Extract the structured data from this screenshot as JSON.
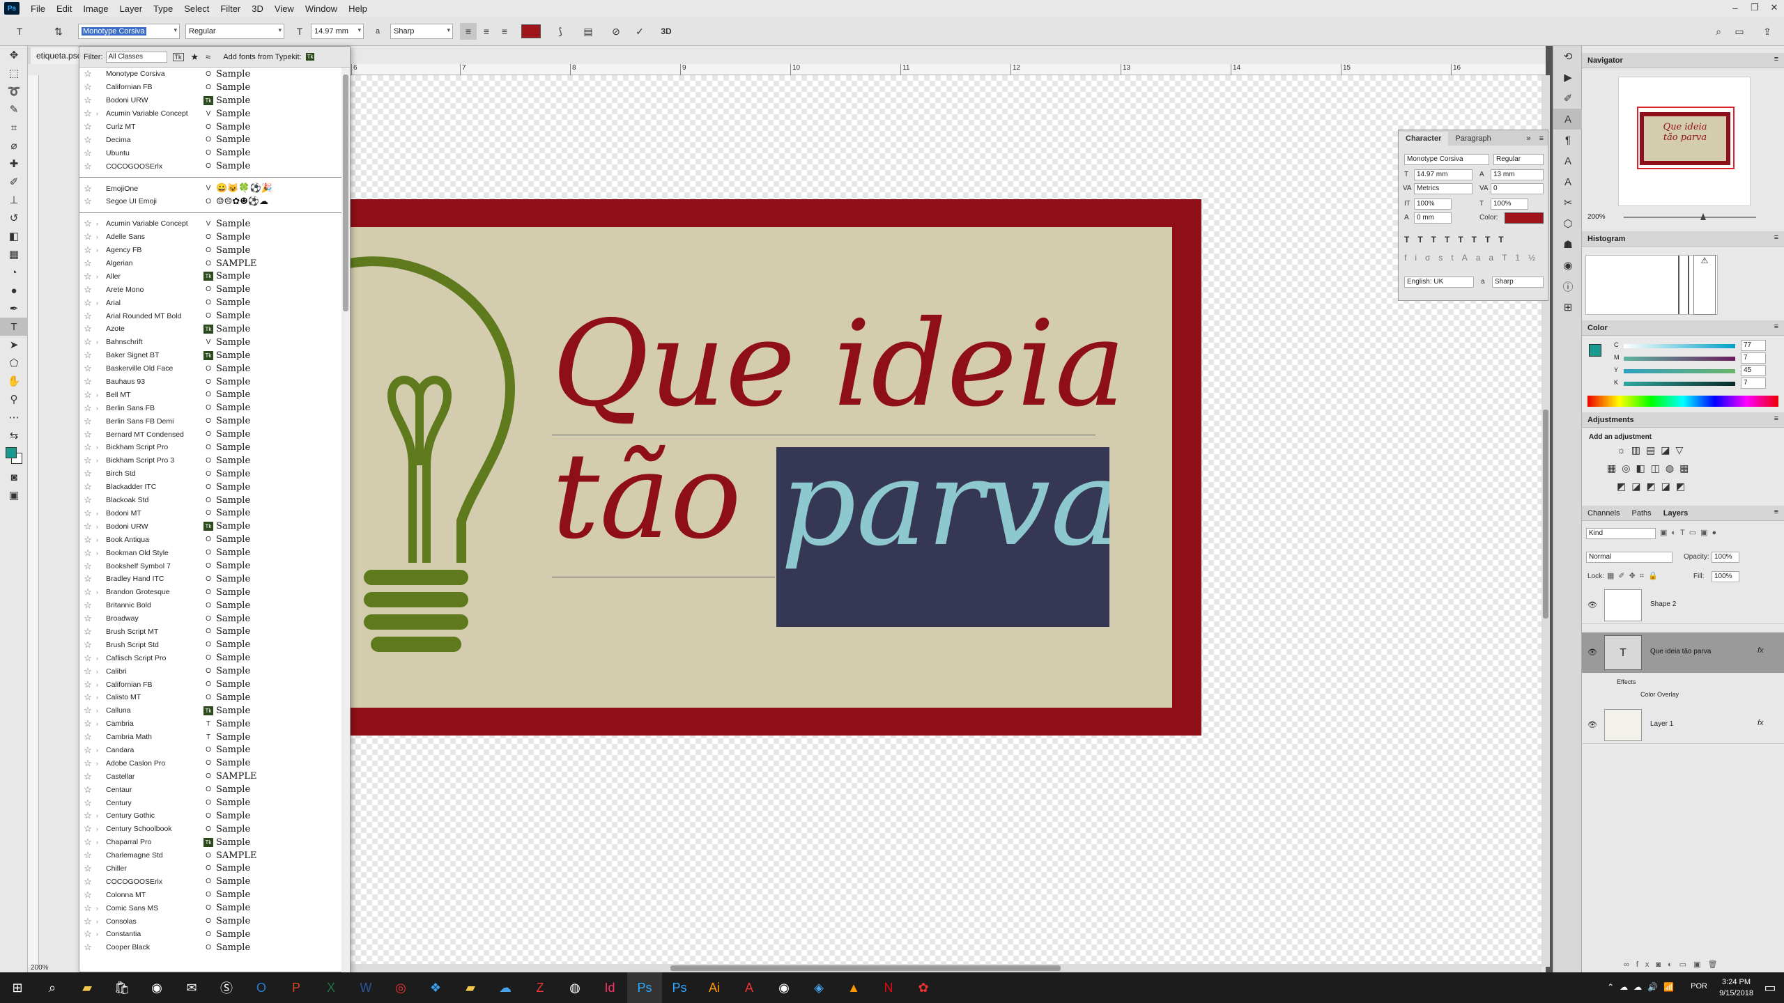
{
  "menubar": {
    "app_logo": "Ps",
    "items": [
      "File",
      "Edit",
      "Image",
      "Layer",
      "Type",
      "Select",
      "Filter",
      "3D",
      "View",
      "Window",
      "Help"
    ]
  },
  "options": {
    "font_family": "Monotype Corsiva",
    "font_style": "Regular",
    "font_size": "14.97 mm",
    "aa_label": "a",
    "aa_value": "Sharp",
    "color": "#a0141c",
    "warp_label": "3D"
  },
  "document": {
    "tab_name": "etiqueta.psd",
    "zoom": "200%",
    "ruler_ticks": [
      "6",
      "7",
      "8",
      "9",
      "10",
      "11",
      "12",
      "13",
      "14",
      "15",
      "16"
    ],
    "artwork": {
      "line1": "Que ideia",
      "line2_a": "tão",
      "line2_b": "parva",
      "border_color": "#8e0f18",
      "bg_color": "#d3ccae",
      "text_color": "#8e0f18",
      "highlight_bg": "#353754",
      "highlight_text": "#8ec8cf",
      "bulb_color": "#5e7a1d"
    }
  },
  "font_menu": {
    "filter_label": "Filter:",
    "filter_value": "All Classes",
    "typekit_label": "Add fonts from Typekit:",
    "recent": [
      {
        "name": "Monotype Corsiva",
        "type": "O",
        "sample": "Sample"
      },
      {
        "name": "Californian FB",
        "type": "O",
        "sample": "Sample"
      },
      {
        "name": "Bodoni URW",
        "type": "Tk",
        "sample": "Sample"
      },
      {
        "name": "Acumin Variable Concept",
        "type": "V",
        "sample": "Sample",
        "arrow": true
      },
      {
        "name": "Curlz MT",
        "type": "O",
        "sample": "Sample"
      },
      {
        "name": "Decima",
        "type": "O",
        "sample": "Sample"
      },
      {
        "name": "Ubuntu",
        "type": "O",
        "sample": "Sample"
      },
      {
        "name": "COCOGOOSErlx",
        "type": "O",
        "sample": "Sample"
      }
    ],
    "emoji": [
      {
        "name": "EmojiOne",
        "type": "V",
        "sample": "😀😺🍀⚽🎉"
      },
      {
        "name": "Segoe UI Emoji",
        "type": "O",
        "sample": "☺☹✿☻⚽☁"
      }
    ],
    "all": [
      {
        "name": "Acumin Variable Concept",
        "type": "V",
        "sample": "Sample",
        "arrow": true
      },
      {
        "name": "Adelle Sans",
        "type": "O",
        "sample": "Sample",
        "arrow": true
      },
      {
        "name": "Agency FB",
        "type": "O",
        "sample": "Sample",
        "arrow": true
      },
      {
        "name": "Algerian",
        "type": "O",
        "sample": "SAMPLE"
      },
      {
        "name": "Aller",
        "type": "Tk",
        "sample": "Sample",
        "arrow": true
      },
      {
        "name": "Arete Mono",
        "type": "O",
        "sample": "Sample"
      },
      {
        "name": "Arial",
        "type": "O",
        "sample": "Sample",
        "arrow": true
      },
      {
        "name": "Arial Rounded MT Bold",
        "type": "O",
        "sample": "Sample"
      },
      {
        "name": "Azote",
        "type": "Tk",
        "sample": "Sample"
      },
      {
        "name": "Bahnschrift",
        "type": "V",
        "sample": "Sample",
        "arrow": true
      },
      {
        "name": "Baker Signet BT",
        "type": "Tk",
        "sample": "Sample"
      },
      {
        "name": "Baskerville Old Face",
        "type": "O",
        "sample": "Sample"
      },
      {
        "name": "Bauhaus 93",
        "type": "O",
        "sample": "Sample"
      },
      {
        "name": "Bell MT",
        "type": "O",
        "sample": "Sample",
        "arrow": true
      },
      {
        "name": "Berlin Sans FB",
        "type": "O",
        "sample": "Sample",
        "arrow": true
      },
      {
        "name": "Berlin Sans FB Demi",
        "type": "O",
        "sample": "Sample"
      },
      {
        "name": "Bernard MT Condensed",
        "type": "O",
        "sample": "Sample"
      },
      {
        "name": "Bickham Script Pro",
        "type": "O",
        "sample": "Sample",
        "arrow": true
      },
      {
        "name": "Bickham Script Pro 3",
        "type": "O",
        "sample": "Sample",
        "arrow": true
      },
      {
        "name": "Birch Std",
        "type": "O",
        "sample": "Sample"
      },
      {
        "name": "Blackadder ITC",
        "type": "O",
        "sample": "Sample"
      },
      {
        "name": "Blackoak Std",
        "type": "O",
        "sample": "Sample"
      },
      {
        "name": "Bodoni MT",
        "type": "O",
        "sample": "Sample",
        "arrow": true
      },
      {
        "name": "Bodoni URW",
        "type": "Tk",
        "sample": "Sample",
        "arrow": true
      },
      {
        "name": "Book Antiqua",
        "type": "O",
        "sample": "Sample",
        "arrow": true
      },
      {
        "name": "Bookman Old Style",
        "type": "O",
        "sample": "Sample",
        "arrow": true
      },
      {
        "name": "Bookshelf Symbol 7",
        "type": "O",
        "sample": "Sample"
      },
      {
        "name": "Bradley Hand ITC",
        "type": "O",
        "sample": "Sample"
      },
      {
        "name": "Brandon Grotesque",
        "type": "O",
        "sample": "Sample",
        "arrow": true
      },
      {
        "name": "Britannic Bold",
        "type": "O",
        "sample": "Sample"
      },
      {
        "name": "Broadway",
        "type": "O",
        "sample": "Sample"
      },
      {
        "name": "Brush Script MT",
        "type": "O",
        "sample": "Sample"
      },
      {
        "name": "Brush Script Std",
        "type": "O",
        "sample": "Sample"
      },
      {
        "name": "Caflisch Script Pro",
        "type": "O",
        "sample": "Sample",
        "arrow": true
      },
      {
        "name": "Calibri",
        "type": "O",
        "sample": "Sample",
        "arrow": true
      },
      {
        "name": "Californian FB",
        "type": "O",
        "sample": "Sample",
        "arrow": true
      },
      {
        "name": "Calisto MT",
        "type": "O",
        "sample": "Sample",
        "arrow": true
      },
      {
        "name": "Calluna",
        "type": "Tk",
        "sample": "Sample",
        "arrow": true
      },
      {
        "name": "Cambria",
        "type": "T",
        "sample": "Sample",
        "arrow": true
      },
      {
        "name": "Cambria Math",
        "type": "T",
        "sample": "Sample"
      },
      {
        "name": "Candara",
        "type": "O",
        "sample": "Sample",
        "arrow": true
      },
      {
        "name": "Adobe Caslon Pro",
        "type": "O",
        "sample": "Sample",
        "arrow": true
      },
      {
        "name": "Castellar",
        "type": "O",
        "sample": "SAMPLE"
      },
      {
        "name": "Centaur",
        "type": "O",
        "sample": "Sample"
      },
      {
        "name": "Century",
        "type": "O",
        "sample": "Sample"
      },
      {
        "name": "Century Gothic",
        "type": "O",
        "sample": "Sample",
        "arrow": true
      },
      {
        "name": "Century Schoolbook",
        "type": "O",
        "sample": "Sample",
        "arrow": true
      },
      {
        "name": "Chaparral Pro",
        "type": "Tk",
        "sample": "Sample",
        "arrow": true
      },
      {
        "name": "Charlemagne Std",
        "type": "O",
        "sample": "SAMPLE"
      },
      {
        "name": "Chiller",
        "type": "O",
        "sample": "Sample"
      },
      {
        "name": "COCOGOOSErlx",
        "type": "O",
        "sample": "Sample"
      },
      {
        "name": "Colonna MT",
        "type": "O",
        "sample": "Sample"
      },
      {
        "name": "Comic Sans MS",
        "type": "O",
        "sample": "Sample",
        "arrow": true
      },
      {
        "name": "Consolas",
        "type": "O",
        "sample": "Sample",
        "arrow": true
      },
      {
        "name": "Constantia",
        "type": "O",
        "sample": "Sample",
        "arrow": true
      },
      {
        "name": "Cooper Black",
        "type": "O",
        "sample": "Sample"
      }
    ]
  },
  "character": {
    "tab1": "Character",
    "tab2": "Paragraph",
    "font": "Monotype Corsiva",
    "style": "Regular",
    "size": "14.97 mm",
    "leading": "13 mm",
    "kerning": "Metrics",
    "tracking": "0",
    "vscale": "100%",
    "hscale": "100%",
    "baseline": "0 mm",
    "color_label": "Color:",
    "language": "English: UK",
    "aa": "Sharp"
  },
  "navigator": {
    "title": "Navigator",
    "zoom": "200%",
    "thumb_line1": "Que ideia",
    "thumb_line2": "tão parva"
  },
  "histogram": {
    "title": "Histogram"
  },
  "color": {
    "title": "Color",
    "c": "77",
    "m": "7",
    "y": "45",
    "k": "7",
    "fg": "#1a9a8e"
  },
  "adjustments": {
    "title": "Adjustments",
    "subtitle": "Add an adjustment"
  },
  "layers": {
    "tab_channels": "Channels",
    "tab_paths": "Paths",
    "tab_layers": "Layers",
    "kind": "Kind",
    "blend": "Normal",
    "opacity_label": "Opacity:",
    "opacity": "100%",
    "lock_label": "Lock:",
    "fill_label": "Fill:",
    "fill": "100%",
    "items": [
      {
        "name": "Shape 2"
      },
      {
        "name": "Que ideia tão parva",
        "fx": "fx"
      },
      {
        "name": "Effects"
      },
      {
        "name": "Color Overlay"
      },
      {
        "name": "Layer 1",
        "fx": "fx"
      }
    ]
  },
  "taskbar": {
    "time": "3:24 PM",
    "date": "9/15/2018",
    "lang": "POR"
  }
}
